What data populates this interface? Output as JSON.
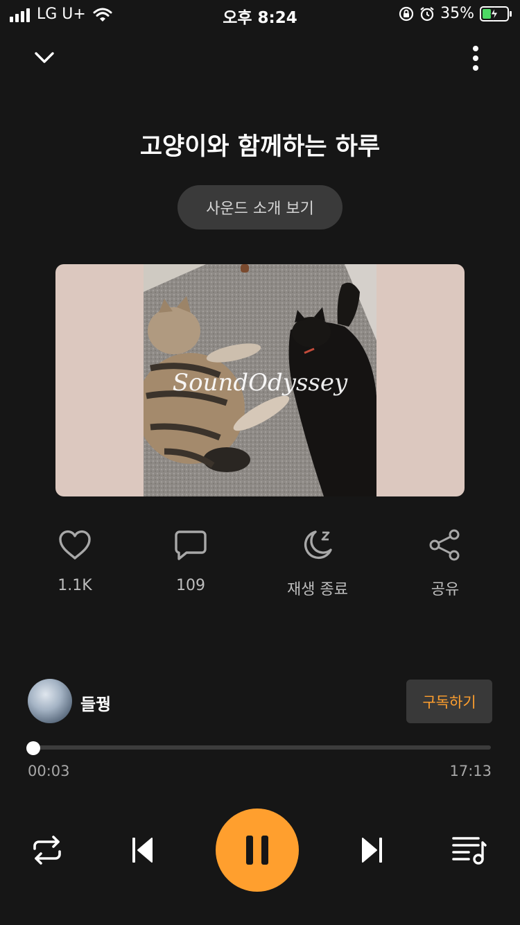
{
  "status_bar": {
    "carrier": "LG U+",
    "time": "오후 8:24",
    "battery_percent": "35%",
    "battery_level": 0.35,
    "icons": [
      "signal-icon",
      "wifi-icon",
      "orientation-lock-icon",
      "alarm-icon",
      "battery-charging-icon"
    ]
  },
  "header": {
    "collapse_icon": "chevron-down-icon",
    "menu_icon": "more-vertical-icon"
  },
  "sound": {
    "title": "고양이와 함께하는 하루",
    "intro_button": "사운드 소개 보기",
    "cover_caption": "SoundOdyssey"
  },
  "actions": [
    {
      "icon": "heart-icon",
      "label": "1.1K"
    },
    {
      "icon": "comment-icon",
      "label": "109"
    },
    {
      "icon": "sleep-timer-icon",
      "label": "재생 종료"
    },
    {
      "icon": "share-icon",
      "label": "공유"
    }
  ],
  "creator": {
    "name": "들꿩",
    "subscribe_label": "구독하기"
  },
  "progress": {
    "current": "00:03",
    "total": "17:13",
    "fraction": 0.003
  },
  "controls": {
    "repeat": "repeat-icon",
    "previous": "skip-previous-icon",
    "play_state": "pause-icon",
    "next": "skip-next-icon",
    "playlist": "playlist-icon"
  },
  "colors": {
    "background": "#161616",
    "accent": "#ff9f2e",
    "battery_fill": "#4cd964"
  }
}
